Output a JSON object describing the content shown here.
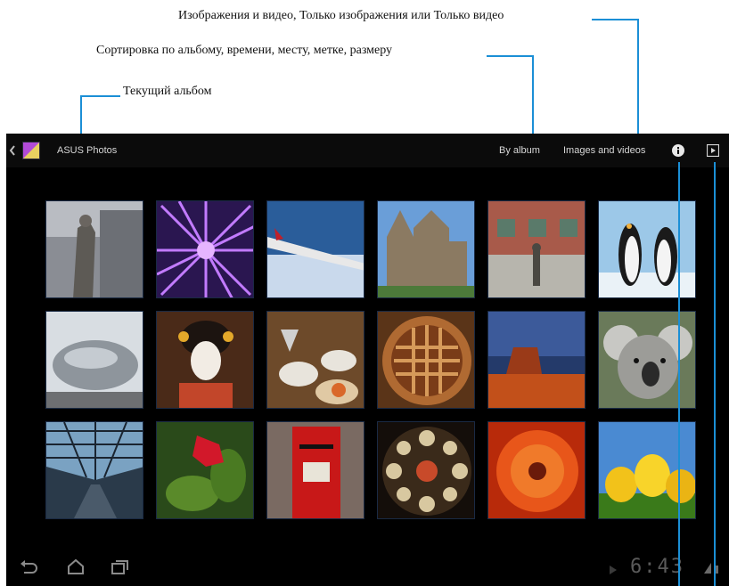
{
  "annotations": {
    "media_filter": "Изображения и видео, Только изображения или Только видео",
    "sort_by": "Сортировка по альбому, времени, месту, метке, размеру",
    "current_album": "Текущий альбом"
  },
  "action_bar": {
    "album_title": "ASUS Photos",
    "sort_label": "By album",
    "filter_label": "Images and videos",
    "info_icon": "info-icon",
    "slideshow_icon": "slideshow-icon",
    "back_icon": "chevron-left-icon",
    "album_icon": "album-thumbnail-icon"
  },
  "photos": [
    {
      "name": "statue",
      "row": 0,
      "col": 0
    },
    {
      "name": "purple-flower",
      "row": 0,
      "col": 1
    },
    {
      "name": "airplane-wing",
      "row": 0,
      "col": 2
    },
    {
      "name": "cathedral",
      "row": 0,
      "col": 3
    },
    {
      "name": "street-statue",
      "row": 0,
      "col": 4
    },
    {
      "name": "penguins",
      "row": 0,
      "col": 5
    },
    {
      "name": "bean-sculpture",
      "row": 1,
      "col": 0
    },
    {
      "name": "geisha",
      "row": 1,
      "col": 1
    },
    {
      "name": "dining-table",
      "row": 1,
      "col": 2
    },
    {
      "name": "pie",
      "row": 1,
      "col": 3
    },
    {
      "name": "desert-mesa",
      "row": 1,
      "col": 4
    },
    {
      "name": "koala",
      "row": 1,
      "col": 5
    },
    {
      "name": "glass-arcade",
      "row": 2,
      "col": 0
    },
    {
      "name": "red-flower",
      "row": 2,
      "col": 1
    },
    {
      "name": "red-postbox",
      "row": 2,
      "col": 2
    },
    {
      "name": "rose-window",
      "row": 2,
      "col": 3
    },
    {
      "name": "orange-flower",
      "row": 2,
      "col": 4
    },
    {
      "name": "yellow-tulips",
      "row": 2,
      "col": 5
    }
  ],
  "nav_bar": {
    "clock": "6:43",
    "back_icon": "back-icon",
    "home_icon": "home-icon",
    "recents_icon": "recent-apps-icon"
  }
}
